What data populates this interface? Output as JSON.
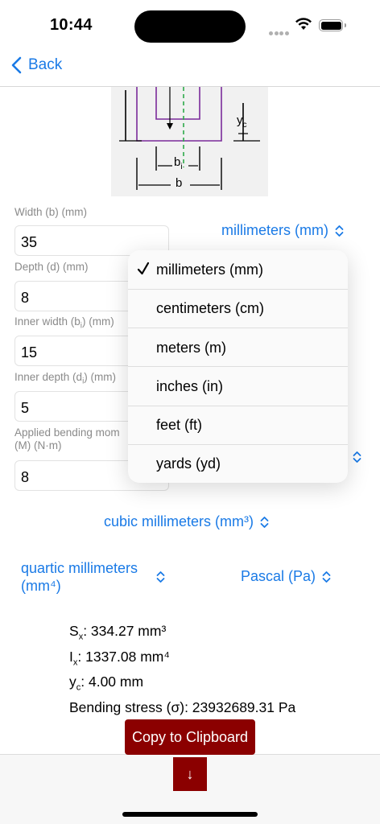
{
  "status": {
    "time": "10:44"
  },
  "nav": {
    "back_label": "Back"
  },
  "diagram": {
    "label_yc": "y",
    "label_yc_sub": "c",
    "label_bi": "b",
    "label_bi_sub": "i",
    "label_b": "b"
  },
  "fields": [
    {
      "label": "Width (b) (mm)",
      "value": "35"
    },
    {
      "label": "Depth (d) (mm)",
      "value": "8"
    },
    {
      "label_pre": "Inner width (b",
      "label_sub": "i",
      "label_post": ") (mm)",
      "value": "15"
    },
    {
      "label_pre": "Inner depth (d",
      "label_sub": "i",
      "label_post": ") (mm)",
      "value": "5"
    },
    {
      "label_line1": "Applied bending mom",
      "label_line2": "(M) (N·m)",
      "value": "8"
    }
  ],
  "pickers": {
    "length_unit": "millimeters (mm)",
    "section_modulus_unit": "cubic millimeters (mm³)",
    "moment_of_inertia_unit_line1": "quartic millimeters",
    "moment_of_inertia_unit_line2": "(mm⁴)",
    "stress_unit": "Pascal (Pa)"
  },
  "dropdown": {
    "selected_index": 0,
    "options": [
      "millimeters (mm)",
      "centimeters (cm)",
      "meters (m)",
      "inches (in)",
      "feet (ft)",
      "yards (yd)"
    ]
  },
  "results": {
    "sx_label": "S",
    "sx_sub": "x",
    "sx_value": ": 334.27 mm³",
    "ix_label": "I",
    "ix_sub": "x",
    "ix_value": ": 1337.08 mm⁴",
    "yc_label": "y",
    "yc_sub": "c",
    "yc_value": ": 4.00  mm",
    "stress": "Bending stress (σ): 23932689.31  Pa"
  },
  "buttons": {
    "copy_label": "Copy to Clipboard",
    "down_label": "↓"
  },
  "colors": {
    "accent": "#1a7ae6",
    "brand_button": "#8b0000",
    "diagram_shape": "#7a2a9a",
    "diagram_centerline": "#2eaa4a"
  }
}
